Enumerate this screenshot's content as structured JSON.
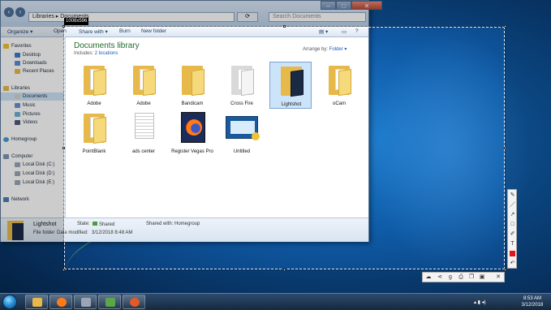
{
  "window": {
    "address": "Libraries ▸ Documents",
    "search_placeholder": "Search Documents",
    "controls": [
      "–",
      "□",
      "✕"
    ]
  },
  "toolbar": {
    "organize": "Organize ▾",
    "open": "Open",
    "share": "Share with ▾",
    "burn": "Burn",
    "new_folder": "New folder"
  },
  "nav": {
    "favorites": "Favorites",
    "desktop": "Desktop",
    "downloads": "Downloads",
    "recent": "Recent Places",
    "libraries": "Libraries",
    "documents": "Documents",
    "music": "Music",
    "pictures": "Pictures",
    "videos": "Videos",
    "homegroup": "Homegroup",
    "computer": "Computer",
    "disk_c": "Local Disk (C:)",
    "disk_d": "Local Disk (D:)",
    "disk_e": "Local Disk (E:)",
    "network": "Network"
  },
  "library": {
    "title": "Documents library",
    "includes_label": "Includes:",
    "includes_link": "2 locations",
    "arrange_label": "Arrange by:",
    "arrange_value": "Folder ▾"
  },
  "files": {
    "f1": "Adobe",
    "f2": "Adobe",
    "f3": "Bandicam",
    "f4": "Cross Fire",
    "f5": "Lightshot",
    "f6": "oCam",
    "f7": "PointBlank",
    "f8": "ads center",
    "f9": "Register Vegas Pro",
    "f10": "Untitled"
  },
  "details": {
    "name": "Lightshot",
    "type": "File folder",
    "modified_label": "Date modified:",
    "modified_value": "3/12/2018 8:48 AM",
    "state_label": "State:",
    "state_value": "Shared",
    "shared_label": "Shared with:",
    "shared_value": "Homegroup"
  },
  "capture": {
    "size_label": "1008x596"
  },
  "clock": {
    "time": "8:53 AM",
    "date": "3/12/2018"
  },
  "colors": {
    "selection_color": "#e4141b",
    "library_title": "#1e6b2a"
  }
}
